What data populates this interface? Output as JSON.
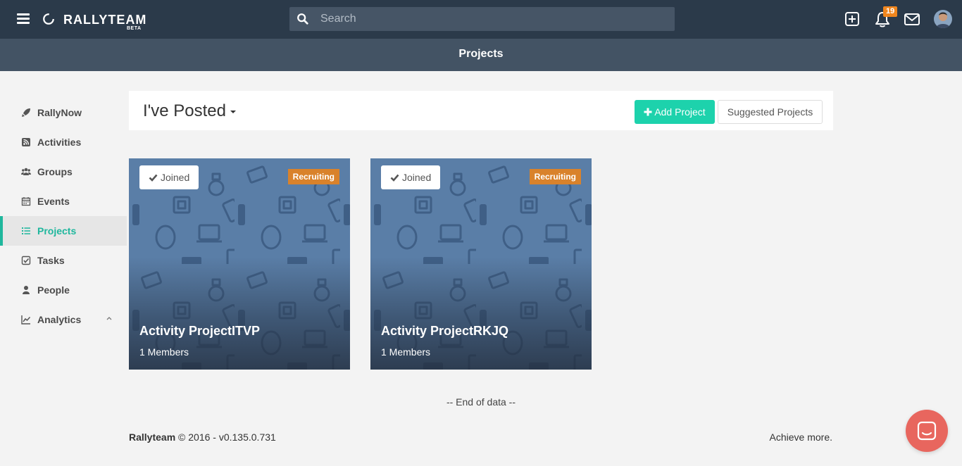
{
  "topbar": {
    "brand": "RALLYTEAM",
    "brand_tag": "BETA",
    "search_placeholder": "Search",
    "notification_count": "19",
    "icons": [
      "menu-icon",
      "plus-square-icon",
      "bell-icon",
      "envelope-icon",
      "avatar"
    ]
  },
  "page": {
    "title": "Projects"
  },
  "sidebar": {
    "items": [
      {
        "label": "RallyNow",
        "icon": "rocket-icon"
      },
      {
        "label": "Activities",
        "icon": "rss-icon"
      },
      {
        "label": "Groups",
        "icon": "users-icon"
      },
      {
        "label": "Events",
        "icon": "calendar-icon"
      },
      {
        "label": "Projects",
        "icon": "list-icon",
        "active": true
      },
      {
        "label": "Tasks",
        "icon": "check-square-icon"
      },
      {
        "label": "People",
        "icon": "user-icon"
      },
      {
        "label": "Analytics",
        "icon": "line-chart-icon"
      }
    ]
  },
  "header": {
    "filter": "I've Posted",
    "add_button": "Add Project",
    "suggested_button": "Suggested Projects"
  },
  "projects": [
    {
      "status": "Joined",
      "badge": "Recruiting",
      "title": "Activity ProjectITVP",
      "members": "1 Members"
    },
    {
      "status": "Joined",
      "badge": "Recruiting",
      "title": "Activity ProjectRKJQ",
      "members": "1 Members"
    }
  ],
  "end_text": "-- End of data --",
  "footer": {
    "brand": "Rallyteam",
    "copyright": "© 2016 - v0.135.0.731",
    "tagline": "Achieve more."
  },
  "colors": {
    "topbar": "#2b3a4a",
    "subheader": "#435364",
    "accent": "#1dd2ac",
    "active_nav": "#1fb79d",
    "badge": "#d9822b",
    "chat": "#e8665e",
    "card": "#5a7ea7"
  }
}
